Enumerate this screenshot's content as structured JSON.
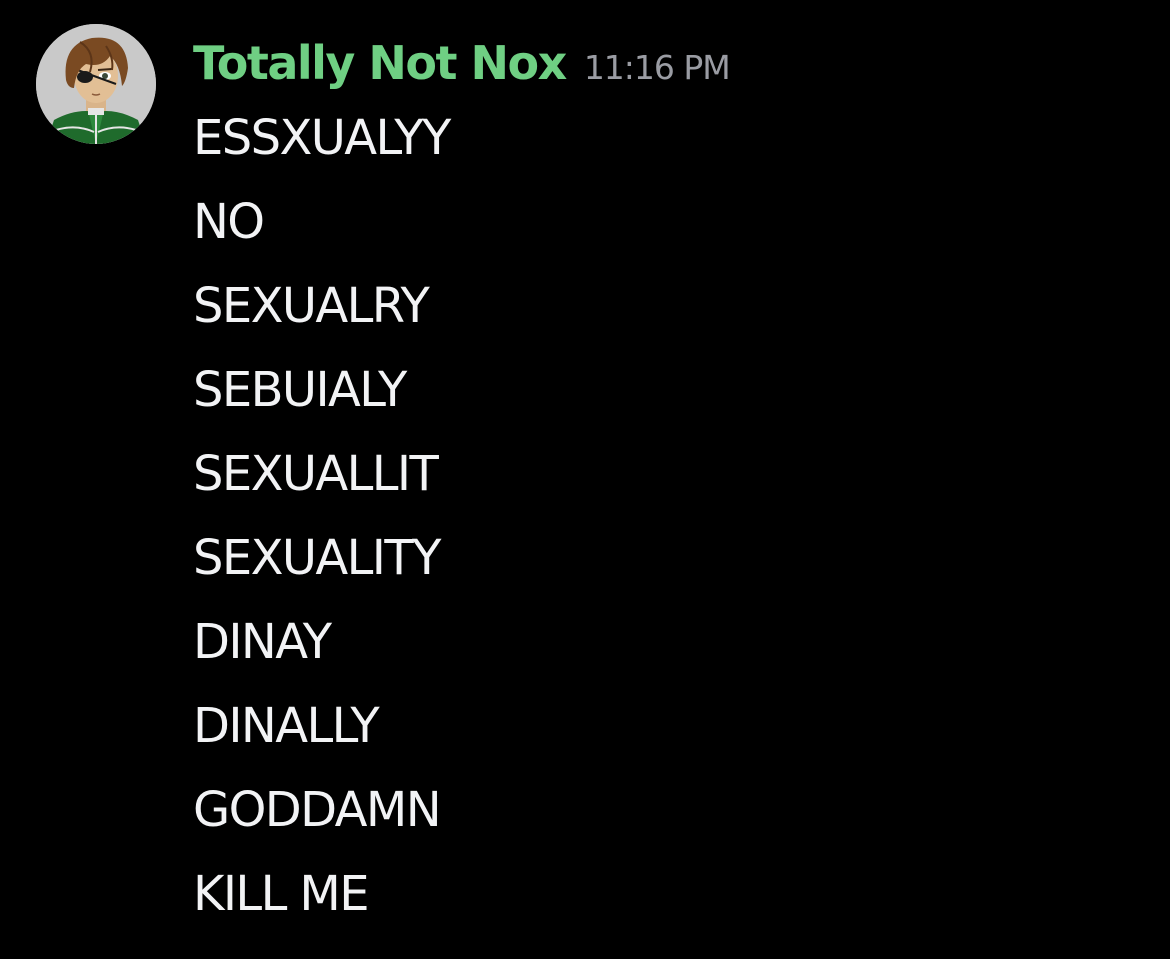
{
  "message": {
    "author": {
      "name": "Totally Not Nox",
      "name_color": "#6fcf83",
      "avatar_icon": "anime-character-avatar"
    },
    "timestamp": "11:16 PM",
    "lines": [
      "ESSXUALYY",
      "NO",
      "SEXUALRY",
      "SEBUIALY",
      "SEXUALLIT",
      "SEXUALITY",
      "DINAY",
      "DINALLY",
      "GODDAMN",
      "KILL ME"
    ]
  },
  "colors": {
    "background": "#000000",
    "text": "#f2f3f5",
    "timestamp": "#9a9ca3"
  }
}
